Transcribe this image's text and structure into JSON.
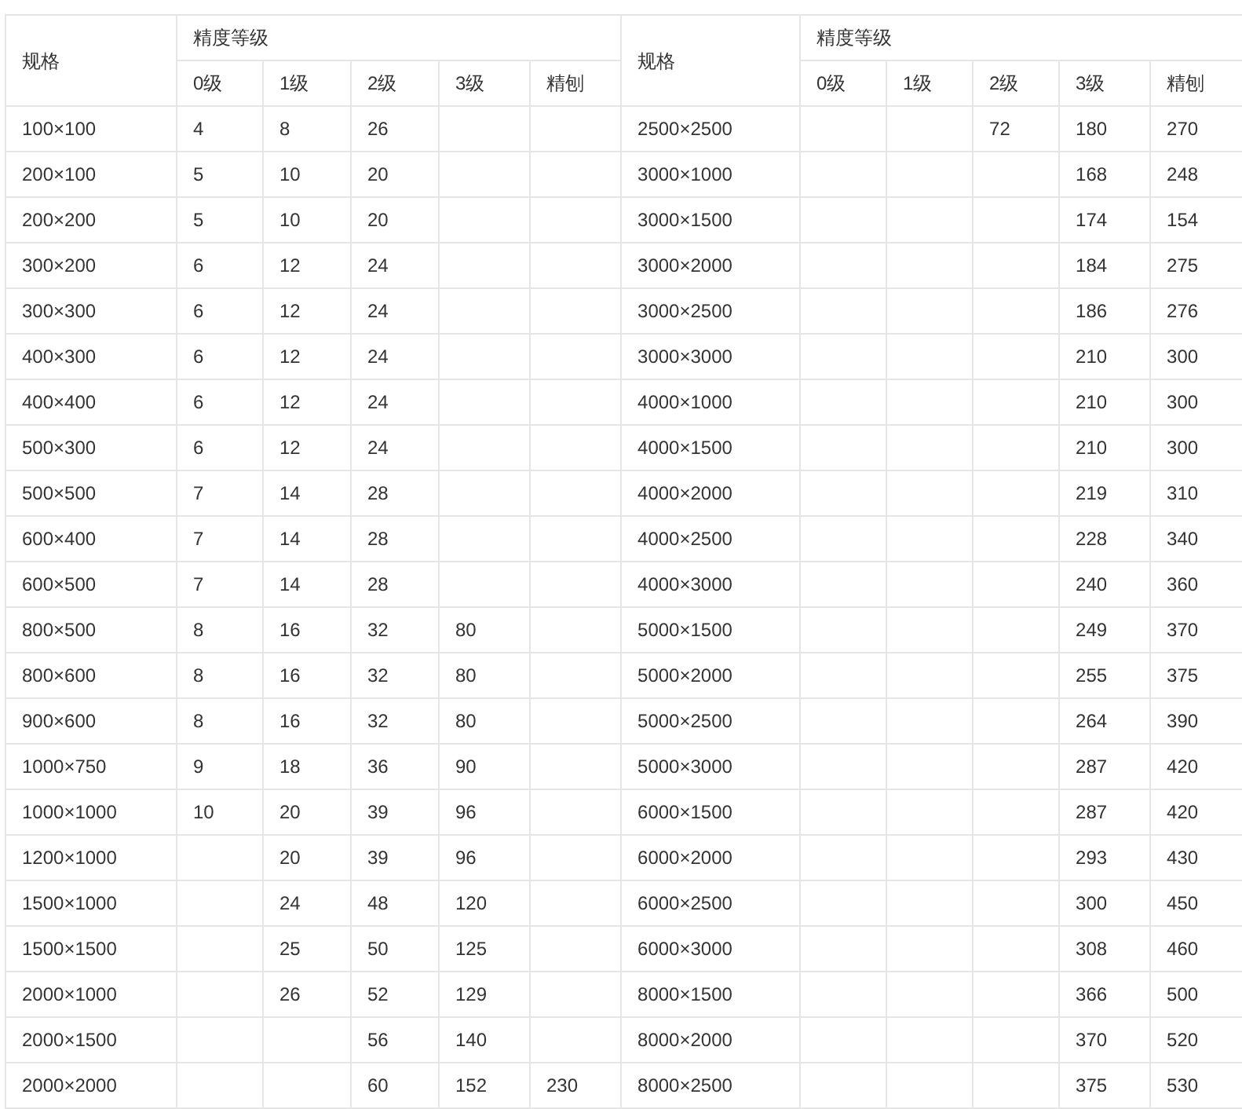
{
  "table": {
    "header_groups": [
      {
        "spec": "规格",
        "group": "精度等级",
        "grades": [
          "0级",
          "1级",
          "2级",
          "3级",
          "精刨"
        ]
      },
      {
        "spec": "规格",
        "group": "精度等级",
        "grades": [
          "0级",
          "1级",
          "2级",
          "3级",
          "精刨"
        ]
      }
    ],
    "rows": [
      [
        "100×100",
        "4",
        "8",
        "26",
        null,
        null,
        "2500×2500",
        null,
        null,
        "72",
        "180",
        "270"
      ],
      [
        "200×100",
        "5",
        "10",
        "20",
        null,
        null,
        "3000×1000",
        null,
        null,
        null,
        "168",
        "248"
      ],
      [
        "200×200",
        "5",
        "10",
        "20",
        null,
        null,
        "3000×1500",
        null,
        null,
        null,
        "174",
        "154"
      ],
      [
        "300×200",
        "6",
        "12",
        "24",
        null,
        null,
        "3000×2000",
        null,
        null,
        null,
        "184",
        "275"
      ],
      [
        "300×300",
        "6",
        "12",
        "24",
        null,
        null,
        "3000×2500",
        null,
        null,
        null,
        "186",
        "276"
      ],
      [
        "400×300",
        "6",
        "12",
        "24",
        null,
        null,
        "3000×3000",
        null,
        null,
        null,
        "210",
        "300"
      ],
      [
        "400×400",
        "6",
        "12",
        "24",
        null,
        null,
        "4000×1000",
        null,
        null,
        null,
        "210",
        "300"
      ],
      [
        "500×300",
        "6",
        "12",
        "24",
        null,
        null,
        "4000×1500",
        null,
        null,
        null,
        "210",
        "300"
      ],
      [
        "500×500",
        "7",
        "14",
        "28",
        null,
        null,
        "4000×2000",
        null,
        null,
        null,
        "219",
        "310"
      ],
      [
        "600×400",
        "7",
        "14",
        "28",
        null,
        null,
        "4000×2500",
        null,
        null,
        null,
        "228",
        "340"
      ],
      [
        "600×500",
        "7",
        "14",
        "28",
        null,
        null,
        "4000×3000",
        null,
        null,
        null,
        "240",
        "360"
      ],
      [
        "800×500",
        "8",
        "16",
        "32",
        "80",
        null,
        "5000×1500",
        null,
        null,
        null,
        "249",
        "370"
      ],
      [
        "800×600",
        "8",
        "16",
        "32",
        "80",
        null,
        "5000×2000",
        null,
        null,
        null,
        "255",
        "375"
      ],
      [
        "900×600",
        "8",
        "16",
        "32",
        "80",
        null,
        "5000×2500",
        null,
        null,
        null,
        "264",
        "390"
      ],
      [
        "1000×750",
        "9",
        "18",
        "36",
        "90",
        null,
        "5000×3000",
        null,
        null,
        null,
        "287",
        "420"
      ],
      [
        "1000×1000",
        "10",
        "20",
        "39",
        "96",
        null,
        "6000×1500",
        null,
        null,
        null,
        "287",
        "420"
      ],
      [
        "1200×1000",
        null,
        "20",
        "39",
        "96",
        null,
        "6000×2000",
        null,
        null,
        null,
        "293",
        "430"
      ],
      [
        "1500×1000",
        null,
        "24",
        "48",
        "120",
        null,
        "6000×2500",
        null,
        null,
        null,
        "300",
        "450"
      ],
      [
        "1500×1500",
        null,
        "25",
        "50",
        "125",
        null,
        "6000×3000",
        null,
        null,
        null,
        "308",
        "460"
      ],
      [
        "2000×1000",
        null,
        "26",
        "52",
        "129",
        null,
        "8000×1500",
        null,
        null,
        null,
        "366",
        "500"
      ],
      [
        "2000×1500",
        null,
        null,
        "56",
        "140",
        null,
        "8000×2000",
        null,
        null,
        null,
        "370",
        "520"
      ],
      [
        "2000×2000",
        null,
        null,
        "60",
        "152",
        "230",
        "8000×2500",
        null,
        null,
        null,
        "375",
        "530"
      ]
    ]
  }
}
